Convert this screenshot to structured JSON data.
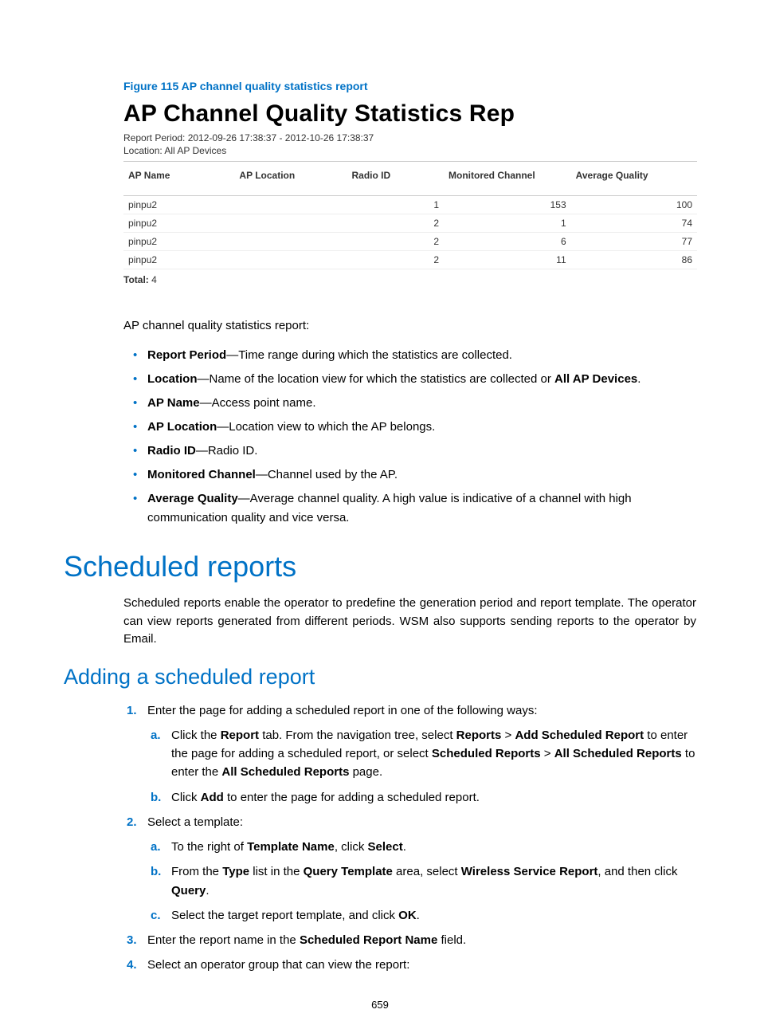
{
  "figure_caption": "Figure 115 AP channel quality statistics report",
  "report": {
    "title": "AP Channel Quality Statistics Rep",
    "period": "Report Period: 2012-09-26 17:38:37  -  2012-10-26 17:38:37",
    "location": "Location: All AP Devices",
    "headers": [
      "AP Name",
      "AP Location",
      "Radio  ID",
      "Monitored Channel",
      "Average Quality"
    ],
    "rows": [
      {
        "ap_name": "pinpu2",
        "ap_location": "",
        "radio_id": "1",
        "monitored_channel": "153",
        "avg_quality": "100"
      },
      {
        "ap_name": "pinpu2",
        "ap_location": "",
        "radio_id": "2",
        "monitored_channel": "1",
        "avg_quality": "74"
      },
      {
        "ap_name": "pinpu2",
        "ap_location": "",
        "radio_id": "2",
        "monitored_channel": "6",
        "avg_quality": "77"
      },
      {
        "ap_name": "pinpu2",
        "ap_location": "",
        "radio_id": "2",
        "monitored_channel": "11",
        "avg_quality": "86"
      }
    ],
    "total_label": "Total:",
    "total_value": "4"
  },
  "intro_line": "AP channel quality statistics report:",
  "definitions": [
    {
      "term": "Report Period",
      "desc": "—Time range during which the statistics are collected."
    },
    {
      "term": "Location",
      "desc_pre": "—Name of the location view for which the statistics are collected or ",
      "desc_bold": "All AP Devices",
      "desc_post": "."
    },
    {
      "term": "AP Name",
      "desc": "—Access point name."
    },
    {
      "term": "AP Location",
      "desc": "—Location view to which the AP belongs."
    },
    {
      "term": "Radio ID",
      "desc": "—Radio ID."
    },
    {
      "term": "Monitored Channel",
      "desc": "—Channel used by the AP."
    },
    {
      "term": "Average Quality",
      "desc": "—Average channel quality. A high value is indicative of a channel with high communication quality and vice versa."
    }
  ],
  "section1": {
    "title": "Scheduled reports",
    "para": "Scheduled reports enable the operator to predefine the generation period and report template. The operator can view reports generated from different periods. WSM also supports sending reports to the operator by Email."
  },
  "section2": {
    "title": "Adding a scheduled report",
    "steps": {
      "s1": "Enter the page for adding a scheduled report in one of the following ways:",
      "s1a_pre": "Click the ",
      "s1a_b1": "Report",
      "s1a_mid1": " tab. From the navigation tree, select ",
      "s1a_b2": "Reports",
      "s1a_gt1": " > ",
      "s1a_b3": "Add Scheduled Report",
      "s1a_mid2": " to enter the page for adding a scheduled report, or select ",
      "s1a_b4": "Scheduled Reports",
      "s1a_gt2": " > ",
      "s1a_b5": "All Scheduled Reports",
      "s1a_mid3": " to enter the ",
      "s1a_b6": "All Scheduled Reports",
      "s1a_end": " page.",
      "s1b_pre": "Click ",
      "s1b_b1": "Add",
      "s1b_end": " to enter the page for adding a scheduled report.",
      "s2": "Select a template:",
      "s2a_pre": "To the right of ",
      "s2a_b1": "Template Name",
      "s2a_mid": ", click ",
      "s2a_b2": "Select",
      "s2a_end": ".",
      "s2b_pre": "From the ",
      "s2b_b1": "Type",
      "s2b_mid1": " list in the ",
      "s2b_b2": "Query Template",
      "s2b_mid2": " area, select ",
      "s2b_b3": "Wireless Service Report",
      "s2b_mid3": ", and then click ",
      "s2b_b4": "Query",
      "s2b_end": ".",
      "s2c_pre": "Select the target report template, and click ",
      "s2c_b1": "OK",
      "s2c_end": ".",
      "s3_pre": "Enter the report name in the ",
      "s3_b1": "Scheduled Report Name",
      "s3_end": " field.",
      "s4": "Select an operator group that can view the report:"
    }
  },
  "page_number": "659"
}
